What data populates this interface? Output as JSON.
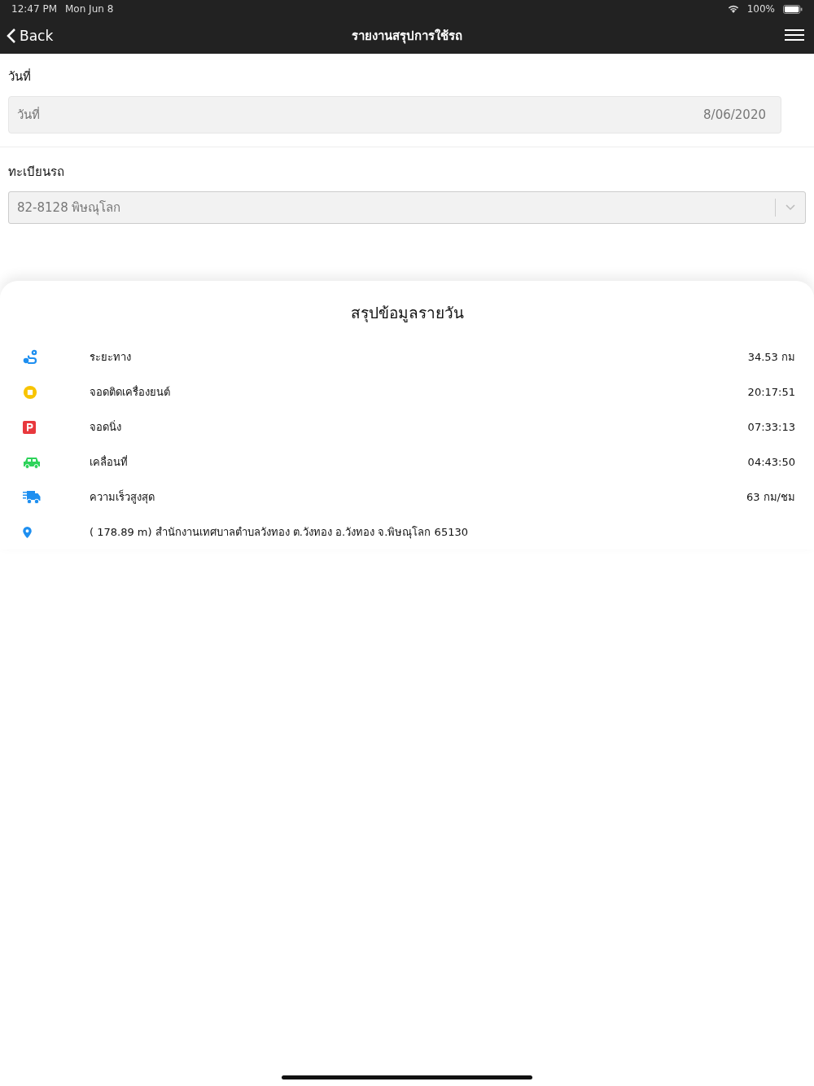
{
  "status_bar": {
    "time": "12:47 PM",
    "date": "Mon Jun 8",
    "battery": "100%"
  },
  "nav": {
    "back": "Back",
    "title": "รายงานสรุปการใช้รถ"
  },
  "date_field": {
    "label": "วันที่",
    "placeholder": "วันที่",
    "value": "8/06/2020"
  },
  "vehicle_field": {
    "label": "ทะเบียนรถ",
    "value": "82-8128 พิษณุโลก"
  },
  "summary": {
    "title": "สรุปข้อมูลรายวัน",
    "rows": [
      {
        "kind": "distance",
        "label": "ระยะทาง",
        "value": "34.53 กม"
      },
      {
        "kind": "idle",
        "label": "จอดติดเครื่องยนต์",
        "value": "20:17:51"
      },
      {
        "kind": "parked",
        "label": "จอดนิ่ง",
        "value": "07:33:13"
      },
      {
        "kind": "moving",
        "label": "เคลื่อนที่",
        "value": "04:43:50"
      },
      {
        "kind": "speed",
        "label": "ความเร็วสูงสุด",
        "value": "63 กม/ชม"
      },
      {
        "kind": "location",
        "label": "( 178.89 m) สำนักงานเทศบาลตำบลวังทอง ต.วังทอง อ.วังทอง จ.พิษณุโลก 65130"
      }
    ]
  }
}
